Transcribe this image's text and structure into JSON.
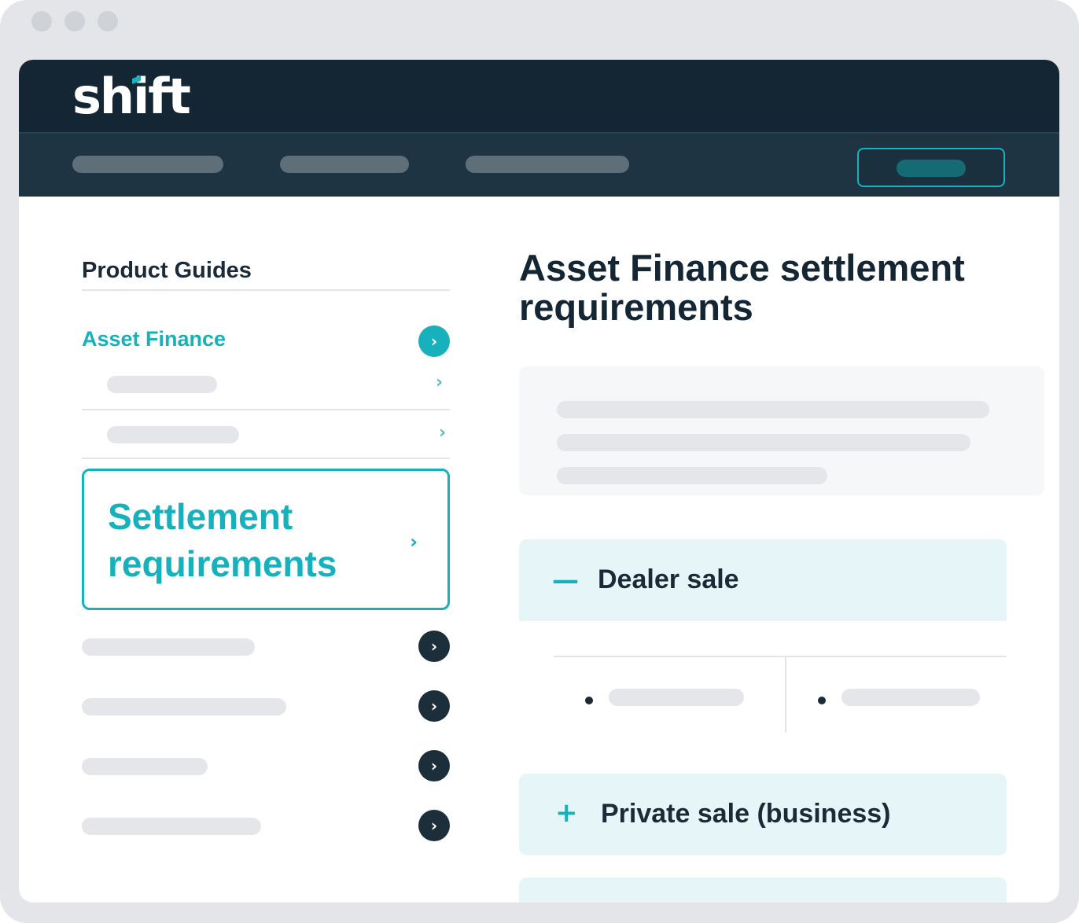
{
  "brand": {
    "name": "shift"
  },
  "sidebar": {
    "title": "Product Guides",
    "active_item": "Asset Finance",
    "highlight_item": "Settlement requirements"
  },
  "main": {
    "title": "Asset Finance settlement requirements",
    "accordions": [
      {
        "label": "Dealer sale",
        "icon": "minus-icon",
        "expanded": true
      },
      {
        "label": "Private sale (business)",
        "icon": "plus-icon",
        "expanded": false
      }
    ]
  },
  "icons": {
    "chevron": "›",
    "minus": "—",
    "plus": "+"
  },
  "colors": {
    "accent": "#16b1bc",
    "navy": "#142634",
    "navbar": "#1e3443",
    "accordion_bg": "#e6f5f7"
  }
}
